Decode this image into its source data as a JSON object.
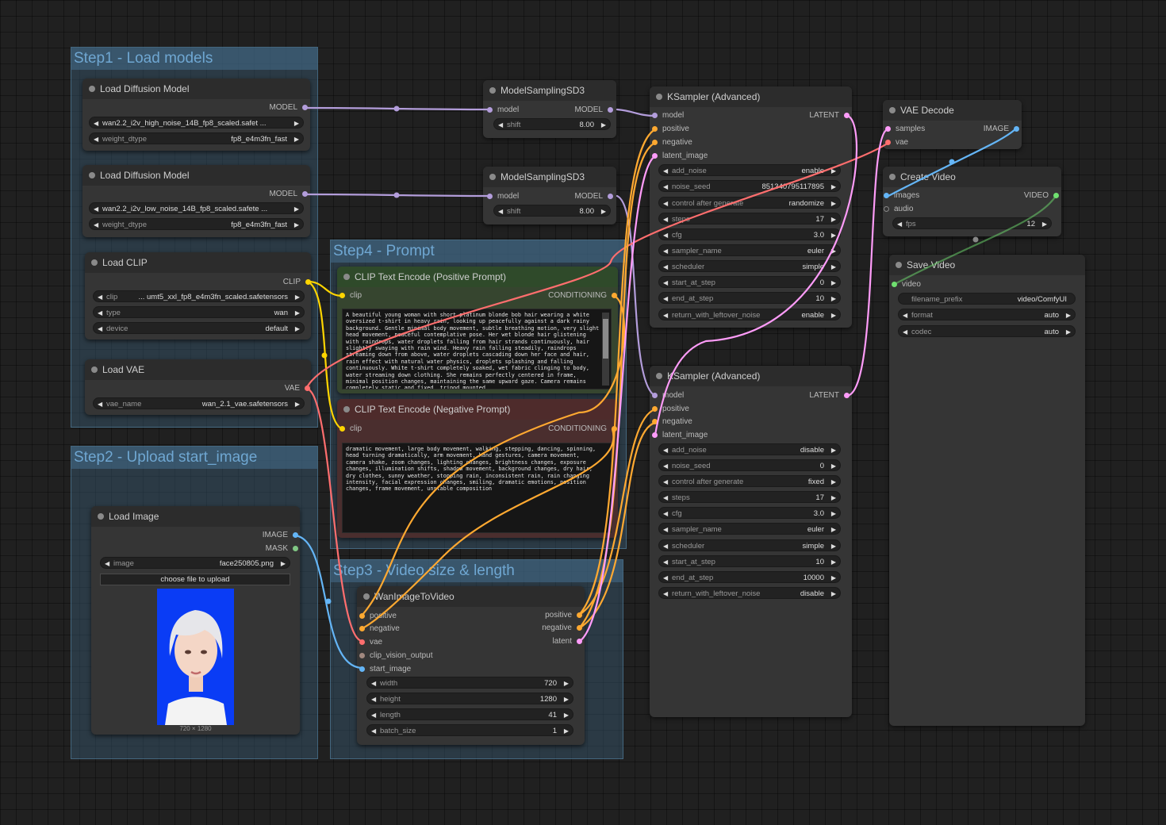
{
  "groups": {
    "step1": "Step1 - Load models",
    "step2": "Step2 - Upload start_image",
    "step3": "Step3 - Video size & length",
    "step4": "Step4 -  Prompt"
  },
  "colors": {
    "model": "#b39ddb",
    "clip": "#ffd500",
    "vae": "#ff6e6e",
    "conditioning": "#ffa931",
    "latent": "#ff9cf9",
    "image": "#64b5f6",
    "video": "#6fe06f",
    "mask": "#81c784"
  },
  "nodes": {
    "load_diffusion_high": {
      "title": "Load Diffusion Model",
      "out_model": "MODEL",
      "unet_name": "wan2.2_i2v_high_noise_14B_fp8_scaled.safet ...",
      "weight_dtype_label": "weight_dtype",
      "weight_dtype": "fp8_e4m3fn_fast"
    },
    "load_diffusion_low": {
      "title": "Load Diffusion Model",
      "out_model": "MODEL",
      "unet_name": "wan2.2_i2v_low_noise_14B_fp8_scaled.safete ...",
      "weight_dtype_label": "weight_dtype",
      "weight_dtype": "fp8_e4m3fn_fast"
    },
    "load_clip": {
      "title": "Load CLIP",
      "out_clip": "CLIP",
      "clip_label": "clip",
      "clip_value": "... umt5_xxl_fp8_e4m3fn_scaled.safetensors",
      "type_label": "type",
      "type_value": "wan",
      "device_label": "device",
      "device_value": "default"
    },
    "load_vae": {
      "title": "Load VAE",
      "out_vae": "VAE",
      "vae_label": "vae_name",
      "vae_value": "wan_2.1_vae.safetensors"
    },
    "load_image": {
      "title": "Load Image",
      "out_image": "IMAGE",
      "out_mask": "MASK",
      "image_label": "image",
      "image_value": "face250805.png",
      "upload_button": "choose file to upload",
      "image_size": "720 × 1280"
    },
    "model_sampling_1": {
      "title": "ModelSamplingSD3",
      "in_model": "model",
      "out_model": "MODEL",
      "shift_label": "shift",
      "shift_value": "8.00"
    },
    "model_sampling_2": {
      "title": "ModelSamplingSD3",
      "in_model": "model",
      "out_model": "MODEL",
      "shift_label": "shift",
      "shift_value": "8.00"
    },
    "clip_positive": {
      "title": "CLIP Text Encode (Positive Prompt)",
      "in_clip": "clip",
      "out_cond": "CONDITIONING",
      "text": "A beautiful young woman with short platinum blonde bob hair wearing a white oversized t-shirt in heavy rain, looking up peacefully against a dark rainy background. Gentle minimal body movement, subtle breathing motion, very slight head movement, peaceful contemplative pose. Her wet blonde hair glistening with raindrops, water droplets falling from hair strands continuously, hair slightly swaying with rain wind. Heavy rain falling steadily, raindrops streaming down from above, water droplets cascading down her face and hair, rain effect with natural water physics, droplets splashing and falling continuously. White t-shirt completely soaked, wet fabric clinging to body, water streaming down clothing. She remains perfectly centered in frame, minimal position changes, maintaining the same upward gaze. Camera remains completely static and fixed, tripod mounted."
    },
    "clip_negative": {
      "title": "CLIP Text Encode (Negative Prompt)",
      "in_clip": "clip",
      "out_cond": "CONDITIONING",
      "text": "dramatic movement, large body movement, walking, stepping, dancing, spinning, head turning dramatically, arm movement, hand gestures, camera movement, camera shake, zoom changes, lighting changes, brightness changes, exposure changes, illumination shifts, shadow movement, background changes, dry hair, dry clothes, sunny weather, stopping rain, inconsistent rain, rain changing intensity, facial expression changes, smiling, dramatic emotions, position changes, frame movement, unstable composition"
    },
    "wan_image_to_video": {
      "title": "WanImageToVideo",
      "in_positive": "positive",
      "in_negative": "negative",
      "in_vae": "vae",
      "in_clip_vision": "clip_vision_output",
      "in_start_image": "start_image",
      "out_positive": "positive",
      "out_negative": "negative",
      "out_latent": "latent",
      "width_label": "width",
      "width": "720",
      "height_label": "height",
      "height": "1280",
      "length_label": "length",
      "length": "41",
      "batch_label": "batch_size",
      "batch": "1"
    },
    "ksampler_1": {
      "title": "KSampler (Advanced)",
      "in_model": "model",
      "in_positive": "positive",
      "in_negative": "negative",
      "in_latent": "latent_image",
      "out_latent": "LATENT",
      "widgets": [
        {
          "label": "add_noise",
          "value": "enable"
        },
        {
          "label": "noise_seed",
          "value": "851340795117895"
        },
        {
          "label": "control after generate",
          "value": "randomize"
        },
        {
          "label": "steps",
          "value": "17"
        },
        {
          "label": "cfg",
          "value": "3.0"
        },
        {
          "label": "sampler_name",
          "value": "euler"
        },
        {
          "label": "scheduler",
          "value": "simple"
        },
        {
          "label": "start_at_step",
          "value": "0"
        },
        {
          "label": "end_at_step",
          "value": "10"
        },
        {
          "label": "return_with_leftover_noise",
          "value": "enable"
        }
      ]
    },
    "ksampler_2": {
      "title": "KSampler (Advanced)",
      "in_model": "model",
      "in_positive": "positive",
      "in_negative": "negative",
      "in_latent": "latent_image",
      "out_latent": "LATENT",
      "widgets": [
        {
          "label": "add_noise",
          "value": "disable"
        },
        {
          "label": "noise_seed",
          "value": "0"
        },
        {
          "label": "control after generate",
          "value": "fixed"
        },
        {
          "label": "steps",
          "value": "17"
        },
        {
          "label": "cfg",
          "value": "3.0"
        },
        {
          "label": "sampler_name",
          "value": "euler"
        },
        {
          "label": "scheduler",
          "value": "simple"
        },
        {
          "label": "start_at_step",
          "value": "10"
        },
        {
          "label": "end_at_step",
          "value": "10000"
        },
        {
          "label": "return_with_leftover_noise",
          "value": "disable"
        }
      ]
    },
    "vae_decode": {
      "title": "VAE Decode",
      "in_samples": "samples",
      "in_vae": "vae",
      "out_image": "IMAGE"
    },
    "create_video": {
      "title": "Create Video",
      "in_images": "images",
      "in_audio": "audio",
      "out_video": "VIDEO",
      "fps_label": "fps",
      "fps_value": "12"
    },
    "save_video": {
      "title": "Save Video",
      "in_video": "video",
      "prefix_label": "filename_prefix",
      "prefix_value": "video/ComfyUI",
      "format_label": "format",
      "format_value": "auto",
      "codec_label": "codec",
      "codec_value": "auto"
    }
  }
}
